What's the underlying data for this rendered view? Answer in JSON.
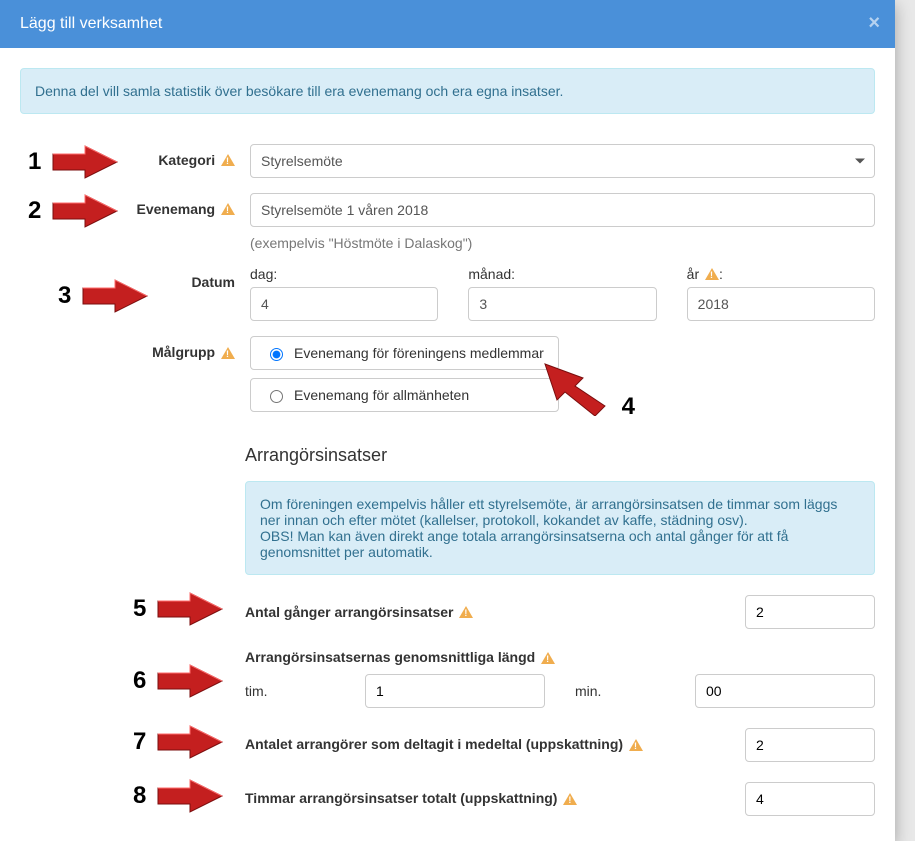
{
  "modal": {
    "title": "Lägg till verksamhet",
    "close": "×"
  },
  "intro_alert": "Denna del vill samla statistik över besökare till era evenemang och era egna insatser.",
  "labels": {
    "kategori": "Kategori",
    "evenemang": "Evenemang",
    "datum": "Datum",
    "malgrupp": "Målgrupp"
  },
  "kategori_value": "Styrelsemöte",
  "evenemang_value": "Styrelsemöte 1 våren 2018",
  "evenemang_hint": "(exempelvis \"Höstmöte i Dalaskog\")",
  "date": {
    "dag_label": "dag:",
    "dag_value": "4",
    "manad_label": "månad:",
    "manad_value": "3",
    "ar_label": "år",
    "ar_suffix": ":",
    "ar_value": "2018"
  },
  "malgrupp": {
    "opt1": "Evenemang för föreningens medlemmar",
    "opt2": "Evenemang för allmänheten"
  },
  "section_title": "Arrangörsinsatser",
  "section_info": "Om föreningen exempelvis håller ett styrelsemöte, är arrangörsinsatsen de timmar som läggs ner innan och efter mötet (kallelser, protokoll, kokandet av kaffe, städning osv).\nOBS! Man kan även direkt ange totala arrangörsinsatserna och antal gånger för att få genomsnittet per automatik.",
  "rows": {
    "antal_ganger": {
      "label": "Antal gånger arrangörsinsatser",
      "value": "2"
    },
    "length": {
      "label": "Arrangörsinsatsernas genomsnittliga längd",
      "tim_label": "tim.",
      "tim_value": "1",
      "min_label": "min.",
      "min_value": "00"
    },
    "antal_arr": {
      "label": "Antalet arrangörer som deltagit i medeltal (uppskattning)",
      "value": "2"
    },
    "timmar_totalt": {
      "label": "Timmar arrangörsinsatser totalt (uppskattning)",
      "value": "4"
    }
  },
  "annotations": {
    "n1": "1",
    "n2": "2",
    "n3": "3",
    "n4": "4",
    "n5": "5",
    "n6": "6",
    "n7": "7",
    "n8": "8"
  }
}
